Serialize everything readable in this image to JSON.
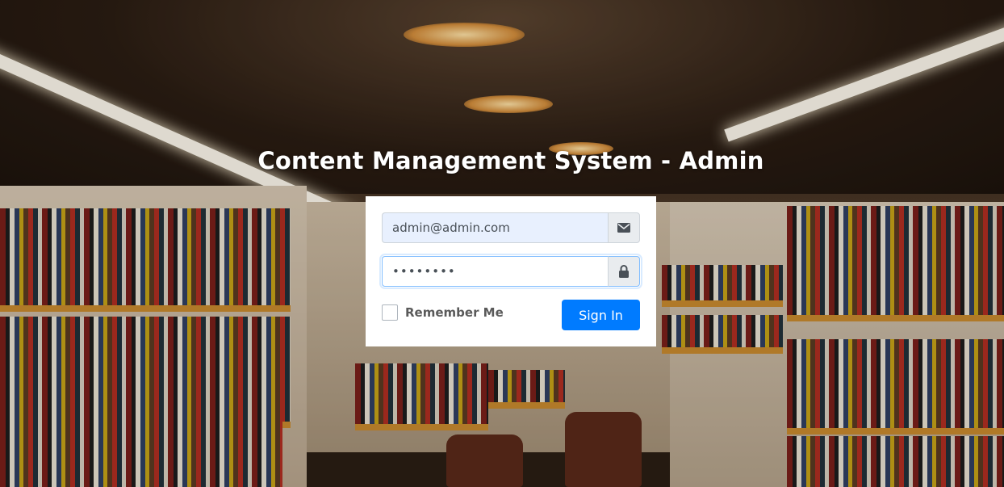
{
  "page": {
    "title": "Content Management System - Admin"
  },
  "login": {
    "email_value": "admin@admin.com",
    "email_icon": "envelope-icon",
    "password_value": "••••••••",
    "password_icon": "lock-icon",
    "remember_label": "Remember Me",
    "remember_checked": false,
    "submit_label": "Sign In"
  },
  "colors": {
    "primary": "#007bff",
    "autofill_bg": "#e8f0fe",
    "addon_bg": "#e9ecef",
    "title_text": "#ffffff"
  },
  "background": {
    "description_icon": "library-bookshelves-photo"
  }
}
